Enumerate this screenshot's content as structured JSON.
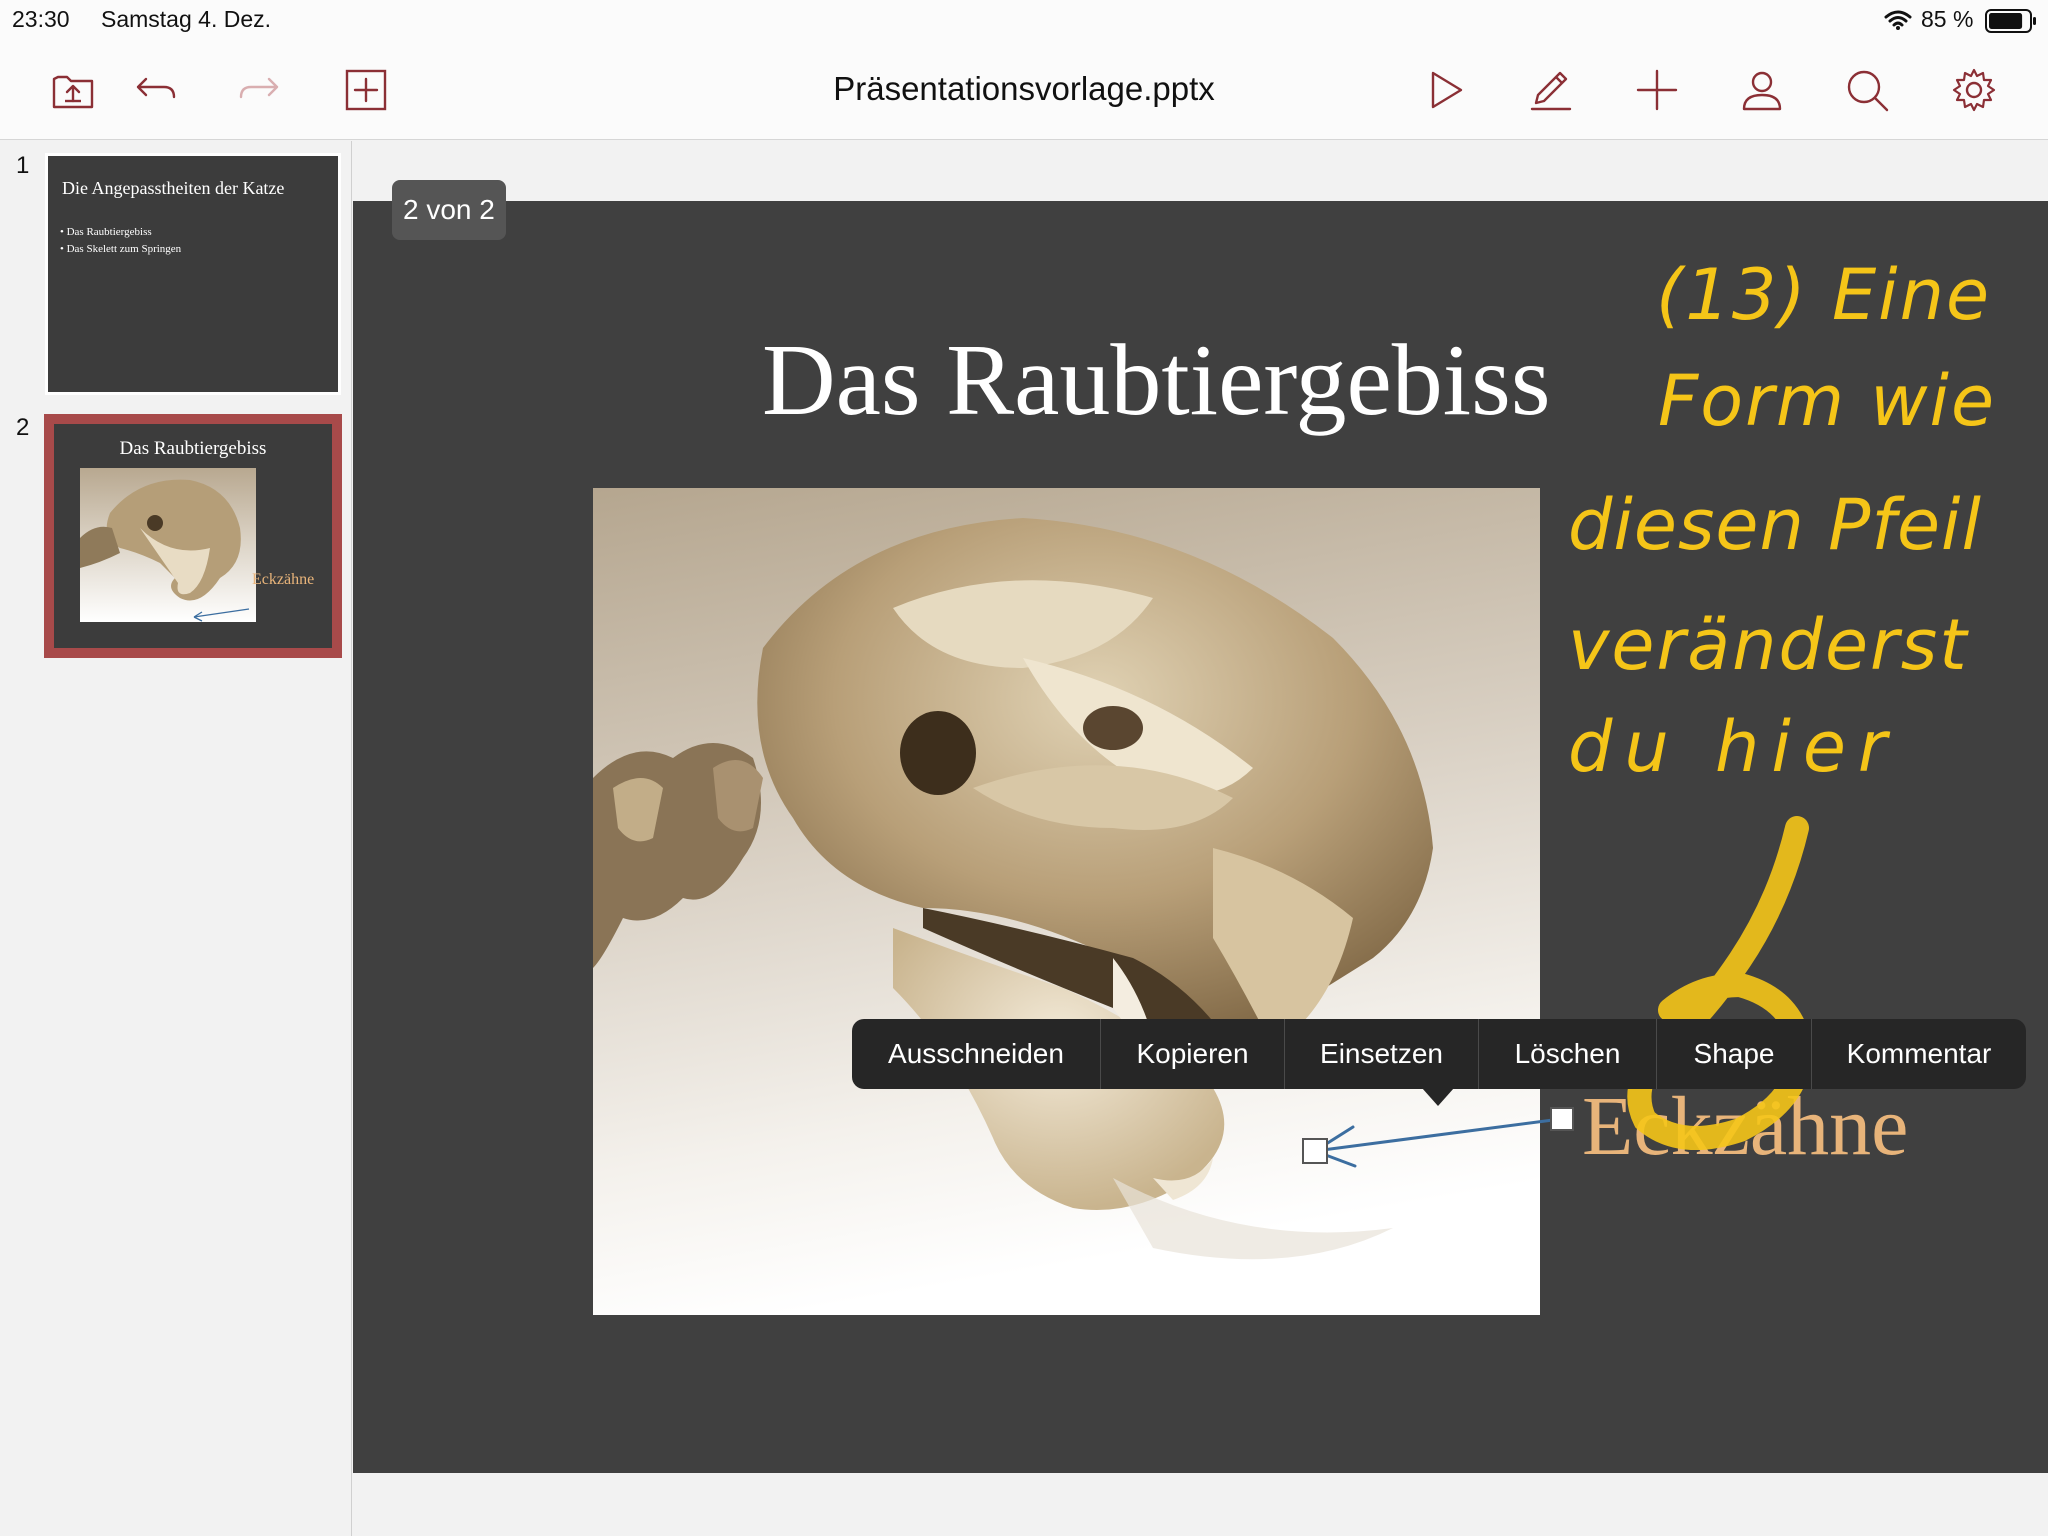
{
  "status_bar": {
    "time": "23:30",
    "date": "Samstag 4. Dez.",
    "battery_percent": "85 %",
    "battery_level": 0.85
  },
  "toolbar": {
    "document_title": "Präsentationsvorlage.pptx",
    "left_icons": [
      "folder-export-icon",
      "undo-icon",
      "redo-icon",
      "add-slide-icon"
    ],
    "right_icons": [
      "play-icon",
      "pencil-icon",
      "plus-icon",
      "person-icon",
      "search-icon",
      "gear-icon"
    ]
  },
  "slide_list": [
    {
      "number": "1",
      "title": "Die Angepasstheiten der Katze",
      "bullets": [
        "• Das Raubtiergebiss",
        "• Das Skelett zum Springen"
      ]
    },
    {
      "number": "2",
      "title": "Das Raubtiergebiss",
      "label": "Eckzähne",
      "selected": true
    }
  ],
  "page_counter": "2 von 2",
  "slide": {
    "title": "Das Raubtiergebiss",
    "label": "Eckzähne"
  },
  "context_menu": {
    "items": [
      "Ausschneiden",
      "Kopieren",
      "Einsetzen",
      "Löschen",
      "Shape",
      "Kommentar"
    ]
  },
  "annotation": {
    "lines": [
      "(13) Eine",
      "Form wie",
      "diesen Pfeil",
      "veränderst",
      "du hier"
    ]
  },
  "colors": {
    "slide_bg": "#404040",
    "selection_border": "#a84a4a",
    "label_color": "#e8b47a",
    "annotation_color": "#f5c518",
    "arrow_color": "#3c6ea0",
    "menu_bg": "#262626"
  }
}
